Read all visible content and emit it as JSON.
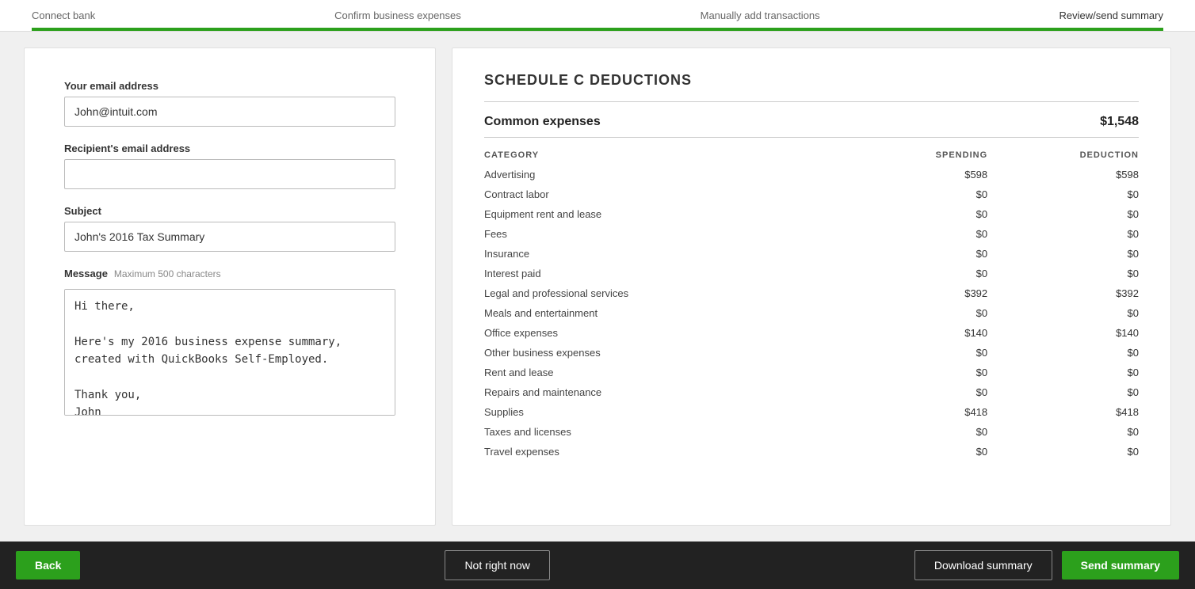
{
  "progress": {
    "steps": [
      {
        "label": "Connect bank",
        "active": false
      },
      {
        "label": "Confirm business expenses",
        "active": false
      },
      {
        "label": "Manually add transactions",
        "active": false
      },
      {
        "label": "Review/send summary",
        "active": true
      }
    ],
    "fill_percent": 100
  },
  "form": {
    "your_email_label": "Your email address",
    "your_email_value": "John@intuit.com",
    "recipient_email_label": "Recipient's email address",
    "recipient_email_value": "",
    "subject_label": "Subject",
    "subject_value": "John's 2016 Tax Summary",
    "message_label": "Message",
    "message_max_chars": "Maximum 500 characters",
    "message_value": "Hi there,\n\nHere's my 2016 business expense summary, created with QuickBooks Self-Employed.\n\nThank you,\nJohn"
  },
  "schedule_c": {
    "title": "SCHEDULE C DEDUCTIONS",
    "common_expenses_label": "Common expenses",
    "common_expenses_total": "$1,548",
    "columns": [
      "CATEGORY",
      "SPENDING",
      "DEDUCTION"
    ],
    "rows": [
      {
        "category": "Advertising",
        "spending": "$598",
        "deduction": "$598"
      },
      {
        "category": "Contract labor",
        "spending": "$0",
        "deduction": "$0"
      },
      {
        "category": "Equipment rent and lease",
        "spending": "$0",
        "deduction": "$0"
      },
      {
        "category": "Fees",
        "spending": "$0",
        "deduction": "$0"
      },
      {
        "category": "Insurance",
        "spending": "$0",
        "deduction": "$0"
      },
      {
        "category": "Interest paid",
        "spending": "$0",
        "deduction": "$0"
      },
      {
        "category": "Legal and professional services",
        "spending": "$392",
        "deduction": "$392"
      },
      {
        "category": "Meals and entertainment",
        "spending": "$0",
        "deduction": "$0"
      },
      {
        "category": "Office expenses",
        "spending": "$140",
        "deduction": "$140"
      },
      {
        "category": "Other business expenses",
        "spending": "$0",
        "deduction": "$0"
      },
      {
        "category": "Rent and lease",
        "spending": "$0",
        "deduction": "$0"
      },
      {
        "category": "Repairs and maintenance",
        "spending": "$0",
        "deduction": "$0"
      },
      {
        "category": "Supplies",
        "spending": "$418",
        "deduction": "$418"
      },
      {
        "category": "Taxes and licenses",
        "spending": "$0",
        "deduction": "$0"
      },
      {
        "category": "Travel expenses",
        "spending": "$0",
        "deduction": "$0"
      }
    ]
  },
  "footer": {
    "back_label": "Back",
    "not_right_now_label": "Not right now",
    "download_label": "Download summary",
    "send_label": "Send summary"
  }
}
